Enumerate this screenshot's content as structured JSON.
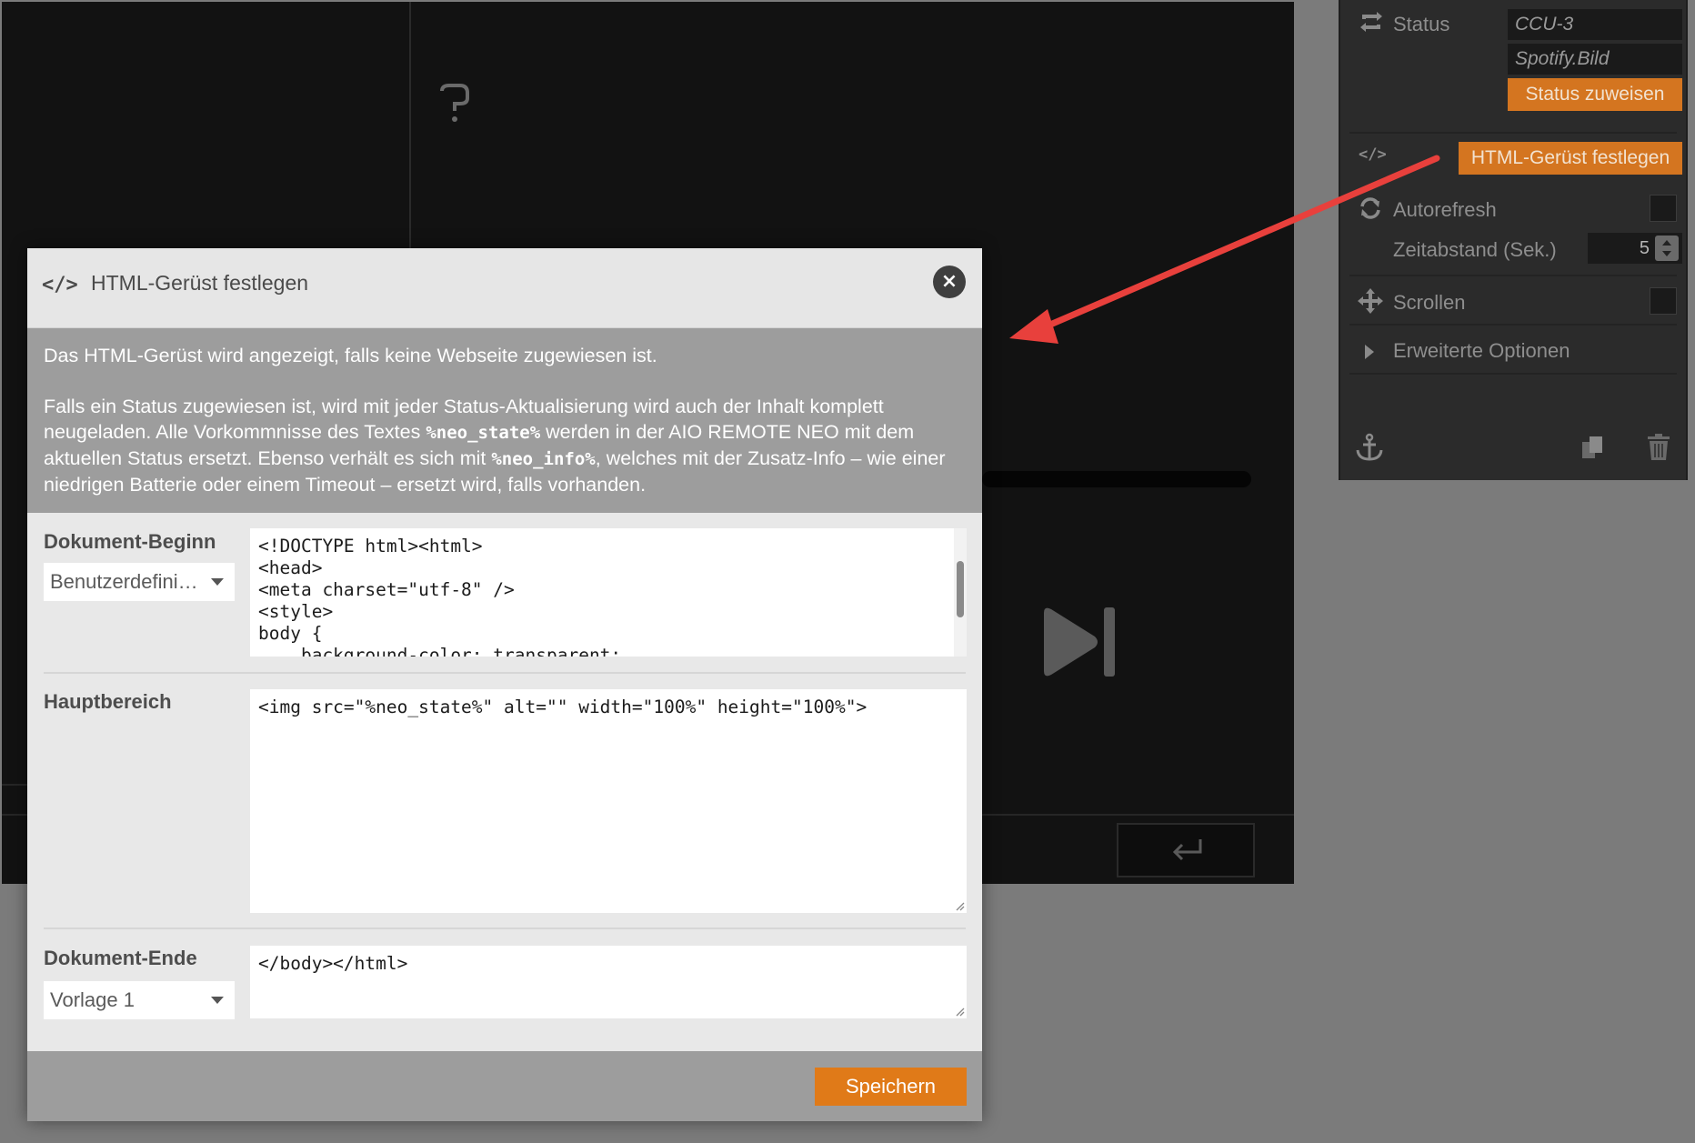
{
  "canvas": {
    "help_icon": "question-mark-icon",
    "next_icon": "skip-next-icon",
    "enter_icon": "return-icon"
  },
  "panel": {
    "status": {
      "label": "Status",
      "field1": "CCU-3",
      "field2": "Spotify.Bild",
      "assign_btn": "Status zuweisen"
    },
    "html_frame_btn": "HTML-Gerüst festlegen",
    "html_icon": "</>",
    "autorefresh": {
      "label": "Autorefresh",
      "checked": false
    },
    "interval": {
      "label": "Zeitabstand (Sek.)",
      "value": "5"
    },
    "scrollen": {
      "label": "Scrollen",
      "checked": false
    },
    "advanced": {
      "label": "Erweiterte Optionen"
    }
  },
  "modal": {
    "title_icon": "</>",
    "title": "HTML-Gerüst festlegen",
    "info1": "Das HTML-Gerüst wird angezeigt, falls keine Webseite zugewiesen ist.",
    "info2a": "Falls ein Status zugewiesen ist, wird mit jeder Status-Aktualisierung wird auch der Inhalt komplett neugeladen. Alle Vorkommnisse des Textes ",
    "token1": "%neo_state%",
    "info2b": " werden in der AIO REMOTE NEO mit dem aktuellen Status ersetzt. Ebenso verhält es sich mit ",
    "token2": "%neo_info%",
    "info2c": ", welches mit der Zusatz-Info – wie einer niedrigen Batterie oder einem Timeout – ersetzt wird, falls vorhanden.",
    "doc_begin": {
      "label": "Dokument-Beginn",
      "select": "Benutzerdefiniert",
      "code": "<!DOCTYPE html><html>\n<head>\n<meta charset=\"utf-8\" />\n<style>\nbody {\n    background-color: transparent;"
    },
    "main": {
      "label": "Hauptbereich",
      "code": "<img src=\"%neo_state%\" alt=\"\" width=\"100%\" height=\"100%\">"
    },
    "doc_end": {
      "label": "Dokument-Ende",
      "select": "Vorlage 1",
      "code": "</body></html>"
    },
    "save_btn": "Speichern"
  },
  "colors": {
    "accent": "#e07a18",
    "annotation_arrow": "#e8403c",
    "panel_bg": "#2b2b2b",
    "canvas_bg": "#121212"
  }
}
